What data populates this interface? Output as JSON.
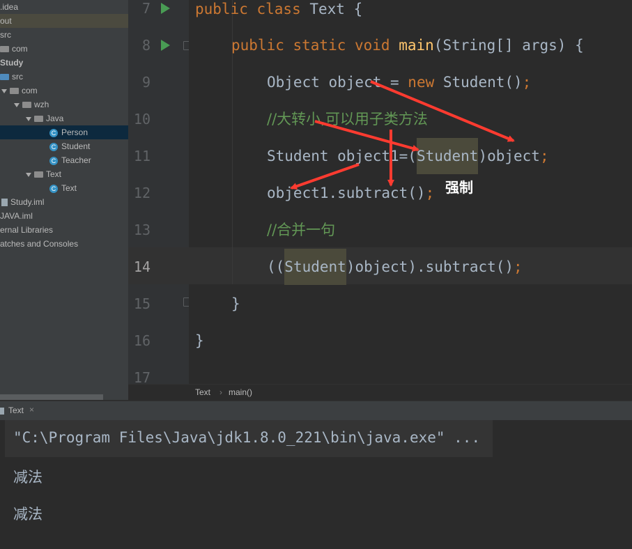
{
  "project_tree": {
    "items": [
      {
        "label": ".idea",
        "kind": "folder"
      },
      {
        "label": "out",
        "kind": "folder"
      },
      {
        "label": "src",
        "kind": "folder"
      },
      {
        "label": "com",
        "kind": "folder"
      },
      {
        "label": "Study",
        "kind": "module"
      },
      {
        "label": "src",
        "kind": "src-folder"
      },
      {
        "label": "com",
        "kind": "folder"
      },
      {
        "label": "wzh",
        "kind": "folder"
      },
      {
        "label": "Java",
        "kind": "folder"
      },
      {
        "label": "Person",
        "kind": "class"
      },
      {
        "label": "Student",
        "kind": "class"
      },
      {
        "label": "Teacher",
        "kind": "class"
      },
      {
        "label": "Text",
        "kind": "folder"
      },
      {
        "label": "Text",
        "kind": "class"
      },
      {
        "label": "Study.iml",
        "kind": "file"
      },
      {
        "label": "JAVA.iml",
        "kind": "file"
      },
      {
        "label": "ernal Libraries",
        "kind": "library"
      },
      {
        "label": "atches and Consoles",
        "kind": "scratch"
      }
    ],
    "selected": "Person"
  },
  "editor": {
    "line_numbers": [
      "7",
      "8",
      "9",
      "10",
      "11",
      "12",
      "13",
      "14",
      "15",
      "16",
      "17"
    ],
    "current_line": "14",
    "lines": {
      "l7": {
        "kw": "public class ",
        "rest": "Text {"
      },
      "l8": {
        "kw": "public static void ",
        "fn": "main",
        "rest": "(String[] args) {"
      },
      "l9": {
        "a": "Object object = ",
        "kw": "new ",
        "b": "Student()",
        "semi": ";"
      },
      "l10": {
        "comment": "//大转小,可以用子类方法"
      },
      "l11": {
        "a": "Student object1=(",
        "hl": "Student",
        "b": ")object",
        "semi": ";"
      },
      "l12": {
        "a": "object1.subtract()",
        "semi": ";"
      },
      "l13": {
        "comment": "//合并一句"
      },
      "l14": {
        "a": "((",
        "hl": "Student",
        "b": ")object).subtract()",
        "semi": ";"
      },
      "l15": {
        "a": "}"
      },
      "l16": {
        "a": "}"
      }
    },
    "annotation": "强制"
  },
  "breadcrumb": {
    "items": [
      "Text",
      "main()"
    ],
    "separator": "›"
  },
  "run_panel": {
    "tab_label": "Text",
    "close_symbol": "×",
    "output": [
      "\"C:\\Program Files\\Java\\jdk1.8.0_221\\bin\\java.exe\" ...",
      "减法",
      "减法"
    ]
  },
  "colors": {
    "keyword": "#cc7832",
    "function": "#ffc66d",
    "comment": "#629755",
    "text": "#a9b7c6",
    "arrow": "#ff3b30"
  }
}
